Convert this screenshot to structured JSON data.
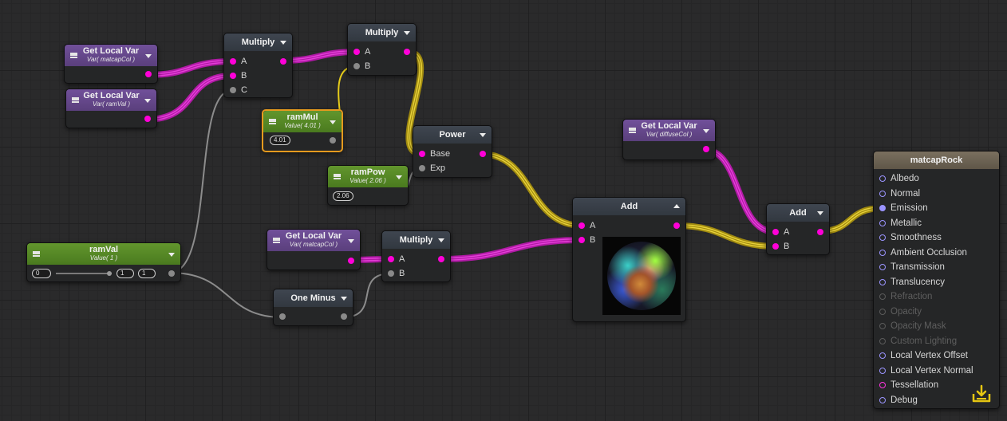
{
  "colors": {
    "wire_color": "#e02ad2",
    "wire_float": "#e6d02a",
    "wire_gray": "#8c8c8c",
    "selected_outline": "#e59a1e"
  },
  "nodes": {
    "get_local_var_1": {
      "title": "Get Local Var",
      "subtitle": "Var( matcapCol )"
    },
    "get_local_var_2": {
      "title": "Get Local Var",
      "subtitle": "Var( ramVal )"
    },
    "multiply_1": {
      "title": "Multiply",
      "inputs": [
        "A",
        "B",
        "C"
      ]
    },
    "multiply_2": {
      "title": "Multiply",
      "inputs": [
        "A",
        "B"
      ]
    },
    "ram_mul": {
      "title": "ramMul",
      "subtitle": "Value( 4.01 )",
      "value": "4.01"
    },
    "ram_pow": {
      "title": "ramPow",
      "subtitle": "Value( 2.06 )",
      "value": "2.06"
    },
    "power": {
      "title": "Power",
      "inputs": [
        "Base",
        "Exp"
      ]
    },
    "get_local_var_3": {
      "title": "Get Local Var",
      "subtitle": "Var( diffuseCol )"
    },
    "ram_val": {
      "title": "ramVal",
      "subtitle": "Value( 1 )",
      "min": "0",
      "max": "1",
      "value": "1"
    },
    "get_local_var_4": {
      "title": "Get Local Var",
      "subtitle": "Var( matcapCol )"
    },
    "multiply_3": {
      "title": "Multiply",
      "inputs": [
        "A",
        "B"
      ]
    },
    "one_minus": {
      "title": "One Minus"
    },
    "add_preview": {
      "title": "Add",
      "inputs": [
        "A",
        "B"
      ]
    },
    "add_2": {
      "title": "Add",
      "inputs": [
        "A",
        "B"
      ]
    },
    "output": {
      "title": "matcapRock",
      "inputs": [
        {
          "label": "Albedo",
          "state": "on"
        },
        {
          "label": "Normal",
          "state": "on"
        },
        {
          "label": "Emission",
          "state": "connected"
        },
        {
          "label": "Metallic",
          "state": "on"
        },
        {
          "label": "Smoothness",
          "state": "on"
        },
        {
          "label": "Ambient Occlusion",
          "state": "on"
        },
        {
          "label": "Transmission",
          "state": "on"
        },
        {
          "label": "Translucency",
          "state": "on"
        },
        {
          "label": "Refraction",
          "state": "disabled"
        },
        {
          "label": "Opacity",
          "state": "disabled"
        },
        {
          "label": "Opacity Mask",
          "state": "disabled"
        },
        {
          "label": "Custom Lighting",
          "state": "disabled"
        },
        {
          "label": "Local Vertex Offset",
          "state": "on"
        },
        {
          "label": "Local Vertex Normal",
          "state": "on"
        },
        {
          "label": "Tessellation",
          "state": "pink"
        },
        {
          "label": "Debug",
          "state": "on"
        }
      ]
    }
  }
}
